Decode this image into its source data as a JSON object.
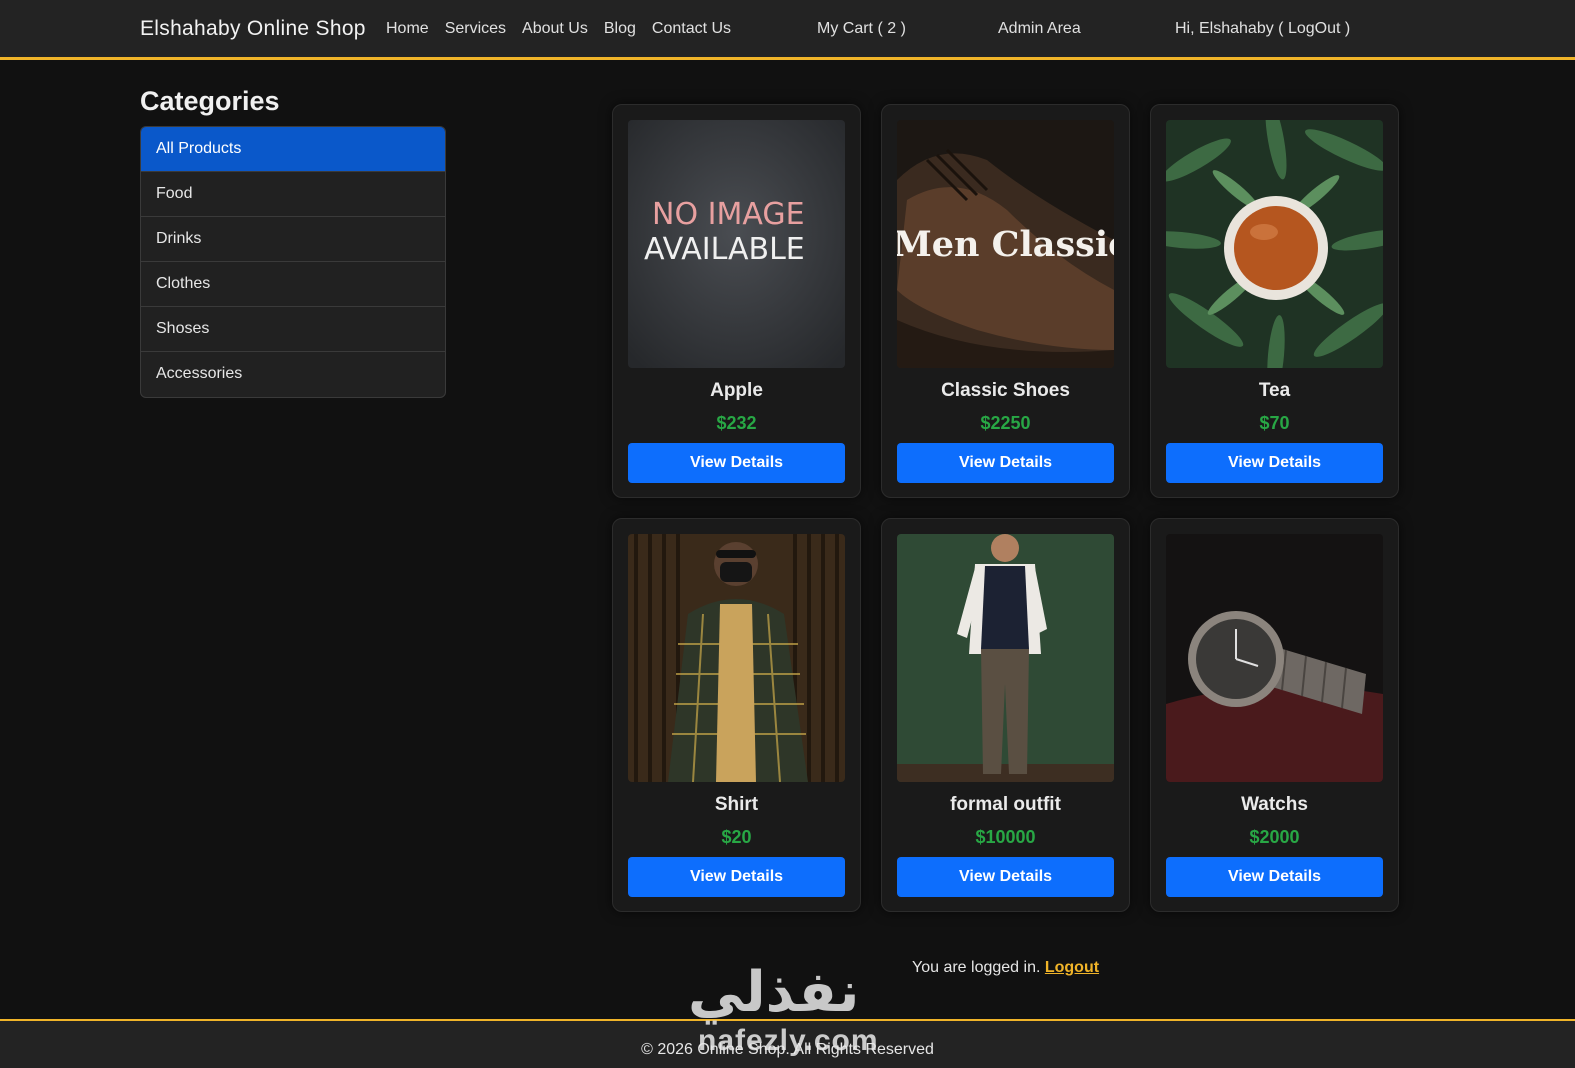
{
  "navbar": {
    "brand": "Elshahaby Online Shop",
    "links": [
      "Home",
      "Services",
      "About Us",
      "Blog",
      "Contact Us"
    ],
    "cart": "My Cart ( 2 )",
    "admin": "Admin Area",
    "user": "Hi, Elshahaby ( LogOut )"
  },
  "sidebar": {
    "title": "Categories",
    "items": [
      "All Products",
      "Food",
      "Drinks",
      "Clothes",
      "Shoses",
      "Accessories"
    ],
    "active_index": 0
  },
  "products": [
    {
      "name": "Apple",
      "price": "$232",
      "button": "View Details",
      "image": "no-image-placeholder"
    },
    {
      "name": "Classic Shoes",
      "price": "$2250",
      "button": "View Details",
      "image": "men-classic-shoe"
    },
    {
      "name": "Tea",
      "price": "$70",
      "button": "View Details",
      "image": "tea-cup-leaves"
    },
    {
      "name": "Shirt",
      "price": "$20",
      "button": "View Details",
      "image": "man-plaid-shirt"
    },
    {
      "name": "formal outfit",
      "price": "$10000",
      "button": "View Details",
      "image": "man-formal-vest"
    },
    {
      "name": "Watchs",
      "price": "$2000",
      "button": "View Details",
      "image": "wrist-watch"
    }
  ],
  "image_text": {
    "no_image_line1": "NO IMAGE",
    "no_image_line2": "AVAILABLE",
    "shoe_banner": "Men Classic"
  },
  "footer": {
    "logged_text": "You are logged in.",
    "logout_link": "Logout",
    "copyright": "© 2026 Online Shop. All Rights Reserved"
  },
  "watermark": {
    "arabic": "نفذلي",
    "latin": "nafezly.com"
  },
  "colors": {
    "accent": "#f0b429",
    "primary_button": "#0d6efd",
    "active_category": "#0a58ca",
    "price": "#28a745"
  }
}
